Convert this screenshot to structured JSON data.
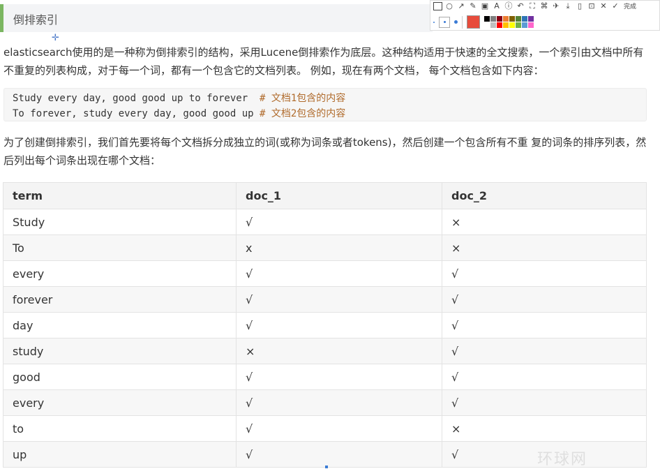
{
  "heading": "倒排索引",
  "paragraph1": "elasticsearch使用的是一种称为倒排索引的结构，采用Lucene倒排索作为底层。这种结构适用于快速的全文搜索，一个索引由文档中所有不重复的列表构成，对于每一个词，都有一个包含它的文档列表。 例如，现在有两个文档， 每个文档包含如下内容：",
  "code": [
    {
      "text": "Study every day, good good up to forever  ",
      "comment": "# 文档1包含的内容"
    },
    {
      "text": "To forever, study every day, good good up ",
      "comment": "# 文档2包含的内容"
    }
  ],
  "paragraph2": "为了创建倒排索引，我们首先要将每个文档拆分成独立的词(或称为词条或者tokens)，然后创建一个包含所有不重 复的词条的排序列表，然后列出每个词条出现在哪个文档：",
  "table": {
    "headers": [
      "term",
      "doc_1",
      "doc_2"
    ],
    "rows": [
      [
        "Study",
        "√",
        "×"
      ],
      [
        "To",
        "x",
        "×"
      ],
      [
        "every",
        "√",
        "√"
      ],
      [
        "forever",
        "√",
        "√"
      ],
      [
        "day",
        "√",
        "√"
      ],
      [
        "study",
        "×",
        "√"
      ],
      [
        "good",
        "√",
        "√"
      ],
      [
        "every",
        "√",
        "√"
      ],
      [
        "to",
        "√",
        "×"
      ],
      [
        "up",
        "√",
        "√"
      ]
    ]
  },
  "toolbar": {
    "done_label": "完成",
    "current_color": "#e74c3c",
    "palette": [
      "#000000",
      "#7f7f7f",
      "#880015",
      "#ed7d31",
      "#7f6000",
      "#548235",
      "#2e75b6",
      "#7030a0",
      "#ffffff",
      "#c0c0c0",
      "#ff0000",
      "#ffc000",
      "#ffff00",
      "#70ad47",
      "#5b9bd5",
      "#ff66cc"
    ]
  },
  "watermark": "环球网"
}
